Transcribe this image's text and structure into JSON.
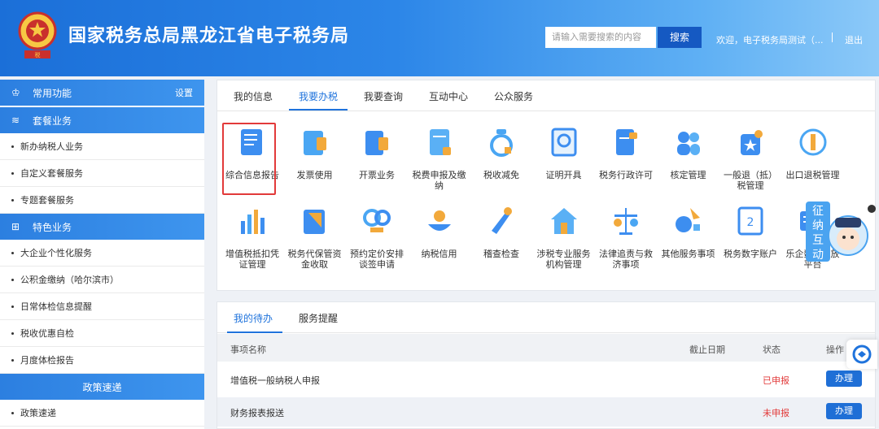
{
  "header": {
    "title": "国家税务总局黑龙江省电子税务局",
    "search_placeholder": "请输入需要搜索的内容",
    "search_button": "搜索",
    "welcome": "欢迎，电子税务局测试（...",
    "logout": "退出",
    "emblem_icon": "tax-emblem-icon"
  },
  "sidebar": {
    "common_head": "常用功能",
    "common_setting": "设置",
    "package_head": "套餐业务",
    "package_items": [
      "新办纳税人业务",
      "自定义套餐服务",
      "专题套餐服务"
    ],
    "special_head": "特色业务",
    "special_items": [
      "大企业个性化服务",
      "公积金缴纳（哈尔滨市）",
      "日常体检信息提醒",
      "税收优惠自检",
      "月度体检报告"
    ],
    "policy_head": "政策速递",
    "policy_items": [
      "政策速递"
    ]
  },
  "main": {
    "tabs": [
      "我的信息",
      "我要办税",
      "我要查询",
      "互动中心",
      "公众服务"
    ],
    "active_tab": 1,
    "services_row1": [
      "综合信息报告",
      "发票使用",
      "开票业务",
      "税费申报及缴纳",
      "税收减免",
      "证明开具",
      "税务行政许可",
      "核定管理",
      "一般退（抵）税管理",
      "出口退税管理"
    ],
    "services_row2": [
      "增值税抵扣凭证管理",
      "税务代保管资金收取",
      "预约定价安排谈签申请",
      "纳税信用",
      "稽查检查",
      "涉税专业服务机构管理",
      "法律追责与救济事项",
      "其他服务事项",
      "税务数字账户",
      "乐企数字开放平台"
    ],
    "service_icon": "2",
    "floater_chars": [
      "征",
      "纳",
      "互",
      "动"
    ]
  },
  "todo": {
    "tabs": [
      "我的待办",
      "服务提醒"
    ],
    "columns": [
      "事项名称",
      "截止日期",
      "状态",
      "操作"
    ],
    "rows": [
      {
        "name": "增值税一般纳税人申报",
        "deadline": "",
        "status": "已申报",
        "action": "办理"
      },
      {
        "name": "财务报表报送",
        "deadline": "",
        "status": "未申报",
        "action": "办理"
      }
    ]
  },
  "colors": {
    "primary": "#1f73dc",
    "highlight": "#e23a3a",
    "header_start": "#1b6fd8"
  }
}
